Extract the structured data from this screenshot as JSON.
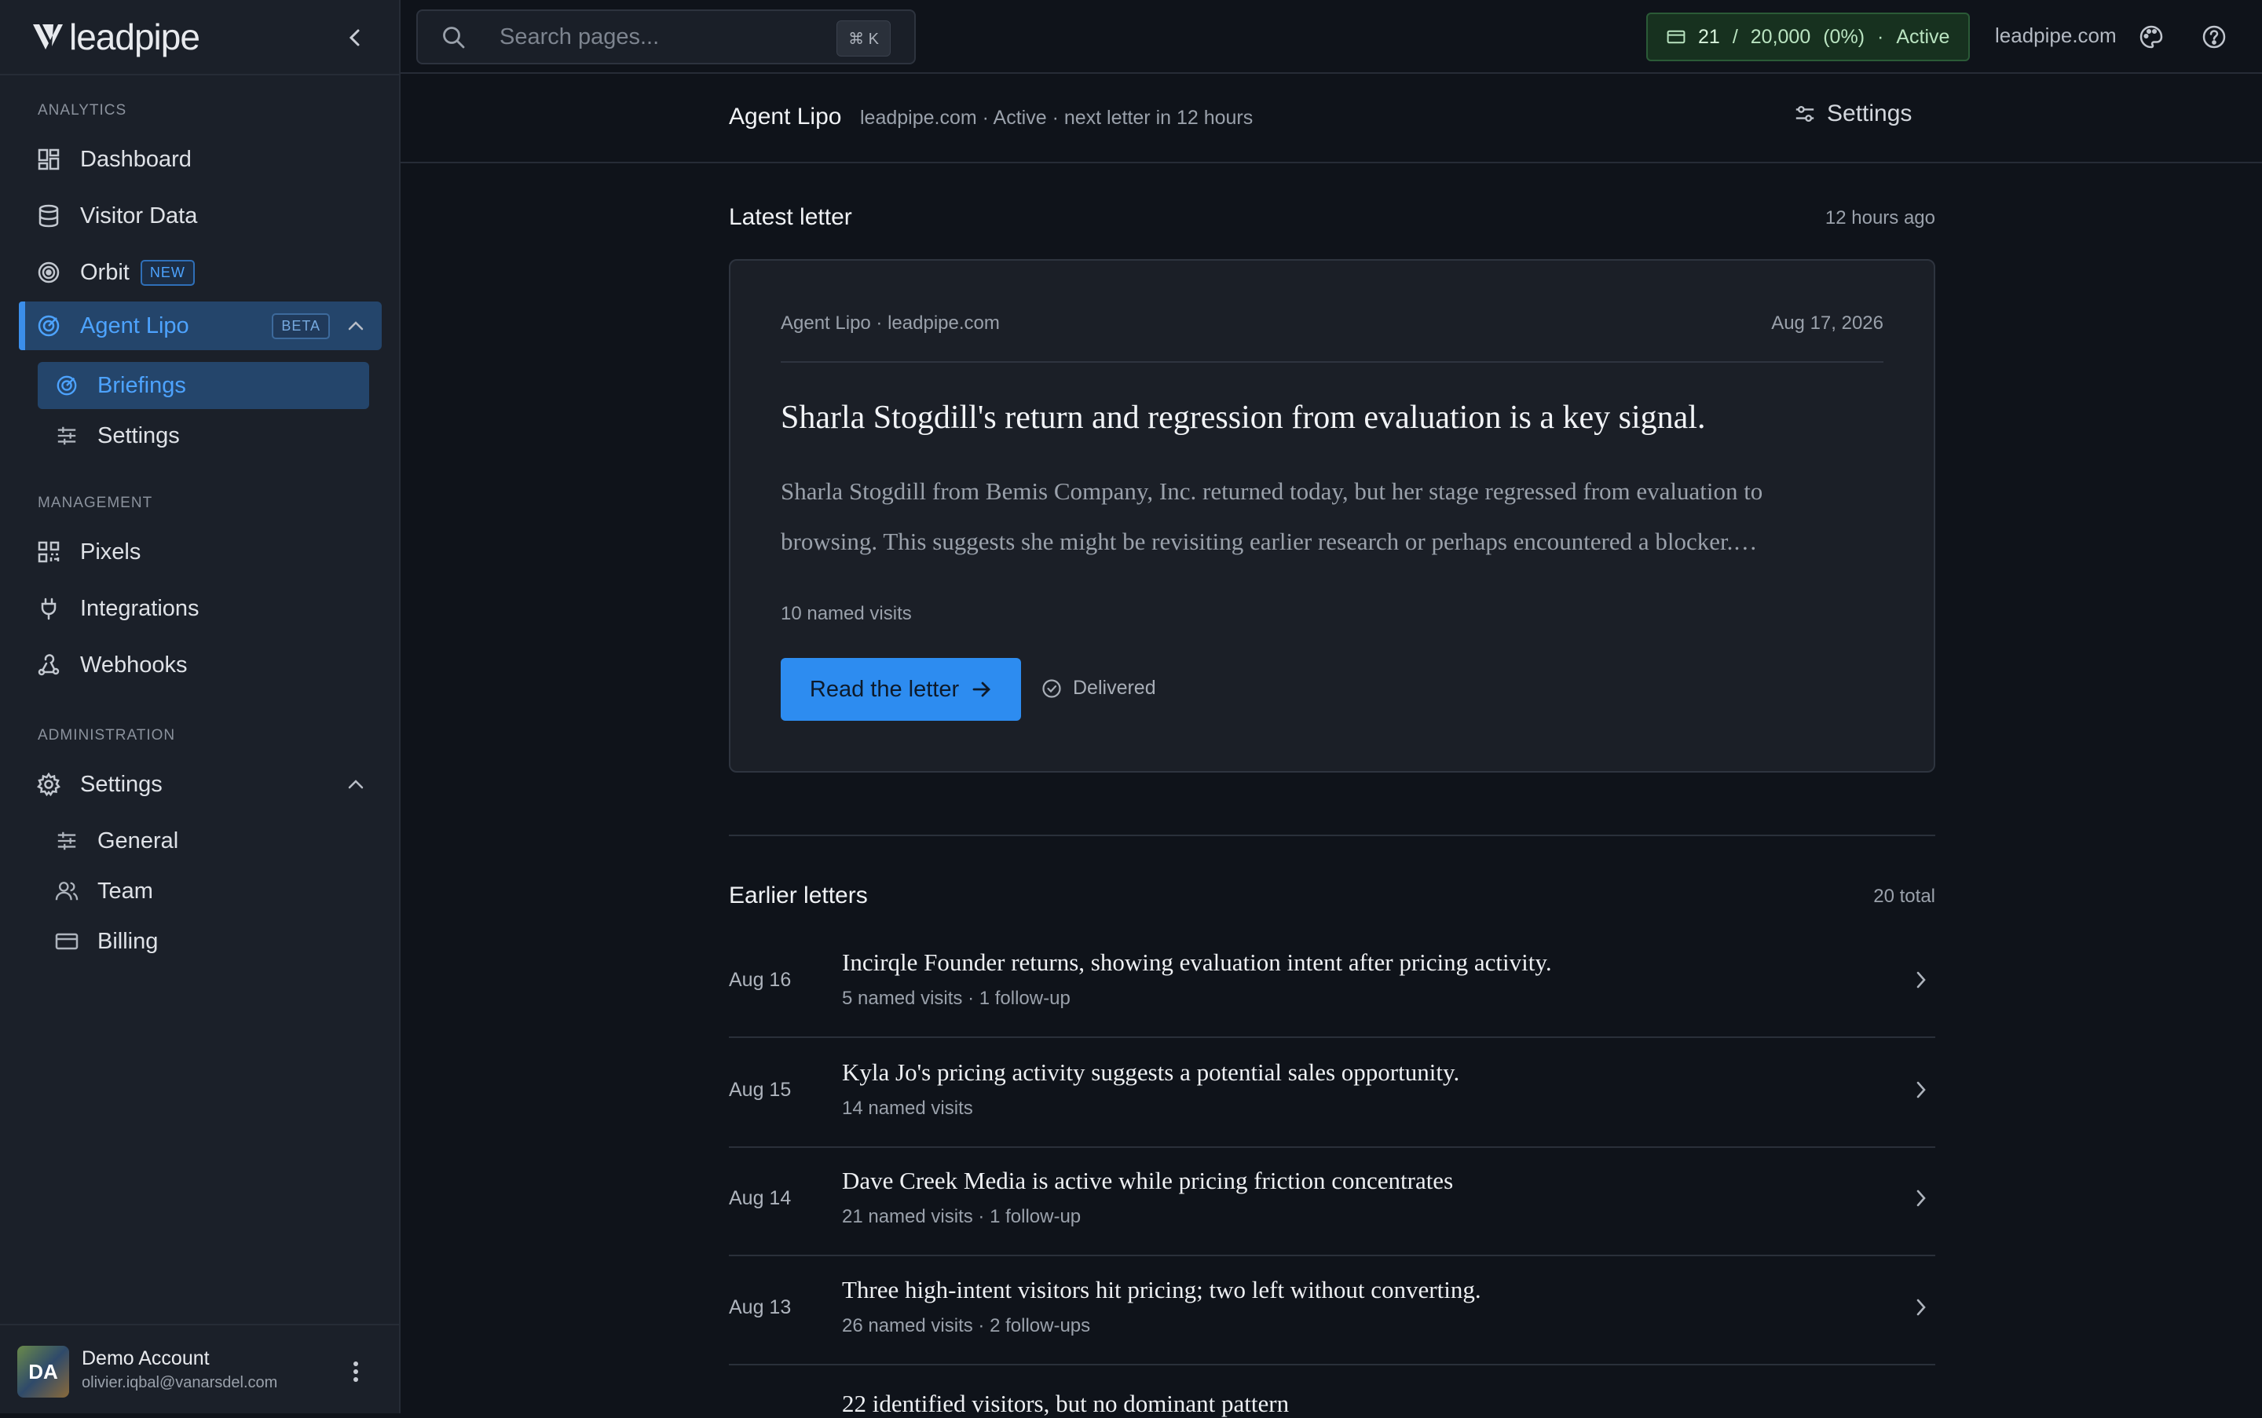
{
  "sidebar": {
    "logo": "leadpipe",
    "sections": {
      "analytics": "ANALYTICS",
      "management": "MANAGEMENT",
      "administration": "ADMINISTRATION"
    },
    "items": {
      "dashboard": "Dashboard",
      "visitor_data": "Visitor Data",
      "orbit": "Orbit",
      "orbit_badge": "NEW",
      "agent_lipo": "Agent Lipo",
      "agent_lipo_badge": "BETA",
      "briefings": "Briefings",
      "agent_settings": "Settings",
      "pixels": "Pixels",
      "integrations": "Integrations",
      "webhooks": "Webhooks",
      "settings": "Settings",
      "general": "General",
      "team": "Team",
      "billing": "Billing"
    },
    "account": {
      "initials": "DA",
      "name": "Demo Account",
      "email": "olivier.iqbal@vanarsdel.com"
    }
  },
  "topbar": {
    "search_placeholder": "Search pages...",
    "search_shortcut": "⌘ K",
    "usage": {
      "used": "21",
      "slash": "/",
      "limit": "20,000",
      "percent": "(0%)",
      "dot": "·",
      "status": "Active"
    },
    "domain": "leadpipe.com"
  },
  "page": {
    "title": "Agent Lipo",
    "subtitle": "leadpipe.com · Active · next letter in 12 hours",
    "settings_label": "Settings"
  },
  "latest": {
    "heading": "Latest letter",
    "time_ago": "12 hours ago",
    "meta": "Agent Lipo · leadpipe.com",
    "date": "Aug 17, 2026",
    "headline": "Sharla Stogdill's return and regression from evaluation is a key signal.",
    "body": "Sharla Stogdill from Bemis Company, Inc. returned today, but her stage regressed from evaluation to browsing. This suggests she might be revisiting earlier research or perhaps encountered a blocker.…",
    "visits": "10 named visits",
    "read_button": "Read the letter",
    "status": "Delivered"
  },
  "earlier": {
    "heading": "Earlier letters",
    "total": "20 total",
    "rows": [
      {
        "date": "Aug 16",
        "title": "Incirqle Founder returns, showing evaluation intent after pricing activity.",
        "sub": "5 named visits · 1 follow-up"
      },
      {
        "date": "Aug 15",
        "title": "Kyla Jo's pricing activity suggests a potential sales opportunity.",
        "sub": "14 named visits"
      },
      {
        "date": "Aug 14",
        "title": "Dave Creek Media is active while pricing friction concentrates",
        "sub": "21 named visits · 1 follow-up"
      },
      {
        "date": "Aug 13",
        "title": "Three high-intent visitors hit pricing; two left without converting.",
        "sub": "26 named visits · 2 follow-ups"
      },
      {
        "date": "",
        "title": "22 identified visitors, but no dominant pattern",
        "sub": ""
      }
    ]
  },
  "colors": {
    "accent": "#2d8cf0",
    "active_nav_bg": "#24456b",
    "usage_bg": "#17311f",
    "background": "#0f131a",
    "sidebar_bg": "#1b2029"
  }
}
